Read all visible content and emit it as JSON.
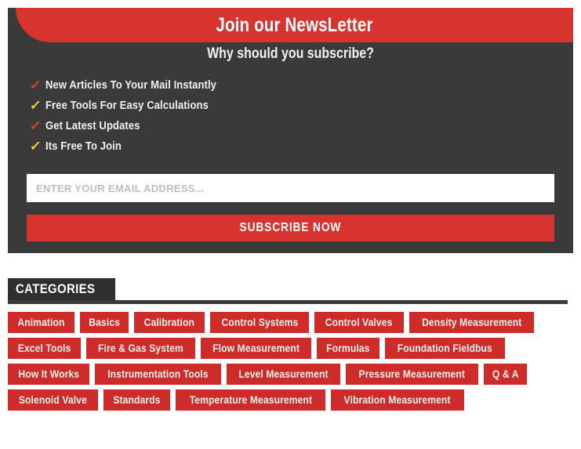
{
  "newsletter": {
    "title": "Join our NewsLetter",
    "subtitle": "Why should you subscribe?",
    "benefits": [
      {
        "icon": "check-icon",
        "label": "New Articles To Your Mail Instantly",
        "color": "#d9451f"
      },
      {
        "icon": "check-icon",
        "label": "Free Tools For Easy Calculations",
        "color": "#e8d92a"
      },
      {
        "icon": "check-icon",
        "label": "Get Latest Updates",
        "color": "#d9451f"
      },
      {
        "icon": "check-icon",
        "label": "Its Free To Join",
        "color": "#e8d92a"
      }
    ],
    "email": {
      "placeholder": "ENTER YOUR EMAIL ADDRESS...",
      "value": ""
    },
    "subscribe_label": "SUBSCRIBE NOW",
    "colors": {
      "header_red": "#d7342f",
      "panel_dark": "#3a3a3a",
      "button_red": "#d7342f"
    }
  },
  "categories": {
    "heading": "CATEGORIES",
    "tag_color": "#ce2b2b",
    "items": [
      {
        "label": "Animation"
      },
      {
        "label": "Basics"
      },
      {
        "label": "Calibration"
      },
      {
        "label": "Control Systems"
      },
      {
        "label": "Control Valves"
      },
      {
        "label": "Density Measurement"
      },
      {
        "label": "Excel Tools"
      },
      {
        "label": "Fire & Gas System"
      },
      {
        "label": "Flow Measurement"
      },
      {
        "label": "Formulas"
      },
      {
        "label": "Foundation Fieldbus"
      },
      {
        "label": "How It Works"
      },
      {
        "label": "Instrumentation Tools"
      },
      {
        "label": "Level Measurement"
      },
      {
        "label": "Pressure Measurement"
      },
      {
        "label": "Q & A"
      },
      {
        "label": "Solenoid Valve"
      },
      {
        "label": "Standards"
      },
      {
        "label": "Temperature Measurement"
      },
      {
        "label": "Vibration Measurement"
      }
    ]
  }
}
